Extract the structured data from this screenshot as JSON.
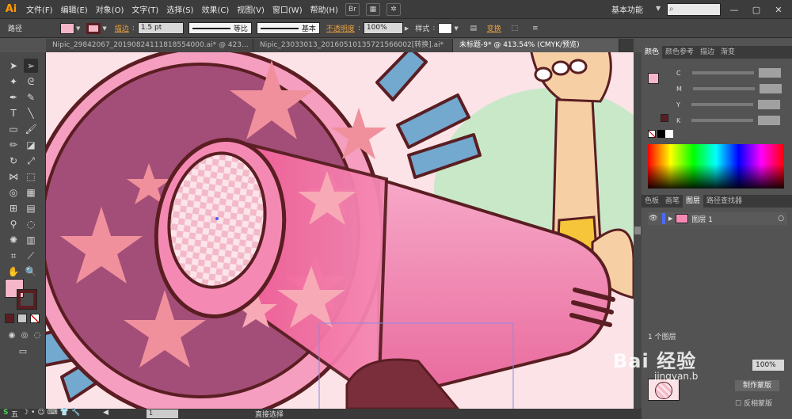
{
  "app": {
    "logo": "Ai",
    "workspace": "基本功能"
  },
  "menu": [
    "文件(F)",
    "编辑(E)",
    "对象(O)",
    "文字(T)",
    "选择(S)",
    "效果(C)",
    "视图(V)",
    "窗口(W)",
    "帮助(H)"
  ],
  "control_bar": {
    "object_type": "路径",
    "stroke_label": "描边",
    "stroke_weight": "1.5 pt",
    "profile_label": "等比",
    "brush_label": "基本",
    "opacity_label": "不透明度",
    "opacity_value": "100%",
    "style_label": "样式",
    "transform_label": "变换"
  },
  "tabs": [
    {
      "label": "Nipic_29842067_20190824111818554000.ai* @ 423...",
      "active": false
    },
    {
      "label": "Nipic_23033013_20160510135721566002[转换].ai*",
      "active": false
    },
    {
      "label": "未标题-9* @ 413.54% (CMYK/预览)",
      "active": true
    }
  ],
  "color_panel": {
    "tabs": [
      "颜色",
      "颜色参考",
      "描边",
      "渐变"
    ],
    "channels": [
      "C",
      "M",
      "Y",
      "K"
    ]
  },
  "layers_panel": {
    "tabs": [
      "色板",
      "画笔",
      "图层",
      "路径查找器"
    ],
    "layer_name": "图层 1",
    "footer": "1 个图层"
  },
  "bottom_panel": {
    "zoom": "100%",
    "make_mask": "制作蒙版",
    "invert_mask": "反相蒙版"
  },
  "status": {
    "zoom_value": "",
    "page": "1",
    "tool_name": "直接选择"
  },
  "taskbar_icons": [
    "五"
  ],
  "watermark": {
    "text": "Bai 经验",
    "sub": "jingyan.b"
  },
  "colors": {
    "accent": "#ff9a00",
    "pink": "#f48fb6",
    "dark_outline": "#5a1e22"
  }
}
